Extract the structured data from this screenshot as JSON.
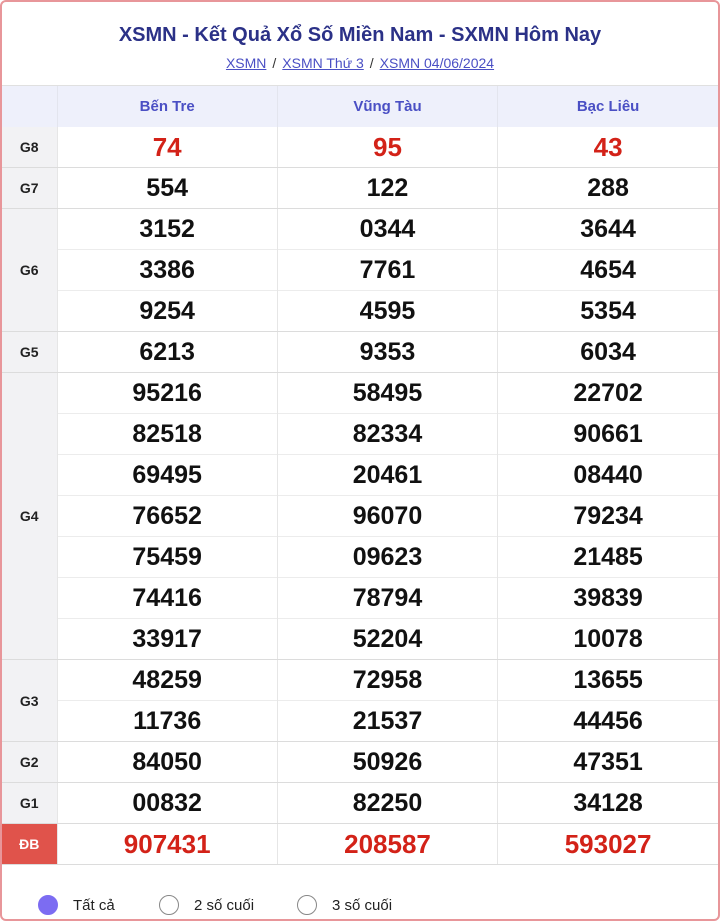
{
  "header": {
    "title": "XSMN - Kết Quả Xổ Số Miền Nam - SXMN Hôm Nay",
    "breadcrumbs": [
      "XSMN",
      "XSMN Thứ 3",
      "XSMN 04/06/2024"
    ]
  },
  "provinces": [
    "Bến Tre",
    "Vũng Tàu",
    "Bạc Liêu"
  ],
  "prizes": [
    {
      "label": "G8",
      "values": [
        [
          "74"
        ],
        [
          "95"
        ],
        [
          "43"
        ]
      ],
      "highlight": true
    },
    {
      "label": "G7",
      "values": [
        [
          "554"
        ],
        [
          "122"
        ],
        [
          "288"
        ]
      ]
    },
    {
      "label": "G6",
      "values": [
        [
          "3152",
          "3386",
          "9254"
        ],
        [
          "0344",
          "7761",
          "4595"
        ],
        [
          "3644",
          "4654",
          "5354"
        ]
      ]
    },
    {
      "label": "G5",
      "values": [
        [
          "6213"
        ],
        [
          "9353"
        ],
        [
          "6034"
        ]
      ]
    },
    {
      "label": "G4",
      "values": [
        [
          "95216",
          "82518",
          "69495",
          "76652",
          "75459",
          "74416",
          "33917"
        ],
        [
          "58495",
          "82334",
          "20461",
          "96070",
          "09623",
          "78794",
          "52204"
        ],
        [
          "22702",
          "90661",
          "08440",
          "79234",
          "21485",
          "39839",
          "10078"
        ]
      ]
    },
    {
      "label": "G3",
      "values": [
        [
          "48259",
          "11736"
        ],
        [
          "72958",
          "21537"
        ],
        [
          "13655",
          "44456"
        ]
      ]
    },
    {
      "label": "G2",
      "values": [
        [
          "84050"
        ],
        [
          "50926"
        ],
        [
          "47351"
        ]
      ]
    },
    {
      "label": "G1",
      "values": [
        [
          "00832"
        ],
        [
          "82250"
        ],
        [
          "34128"
        ]
      ]
    },
    {
      "label": "ĐB",
      "values": [
        [
          "907431"
        ],
        [
          "208587"
        ],
        [
          "593027"
        ]
      ],
      "highlight": true,
      "special": true
    }
  ],
  "filters": {
    "options": [
      "Tất cả",
      "2 số cuối",
      "3 số cuối"
    ],
    "selected": "Tất cả"
  },
  "colors": {
    "accent": "#7c6cf2",
    "title": "#2b3187",
    "prize_highlight": "#d32218",
    "special_label_bg": "#e0534b"
  }
}
